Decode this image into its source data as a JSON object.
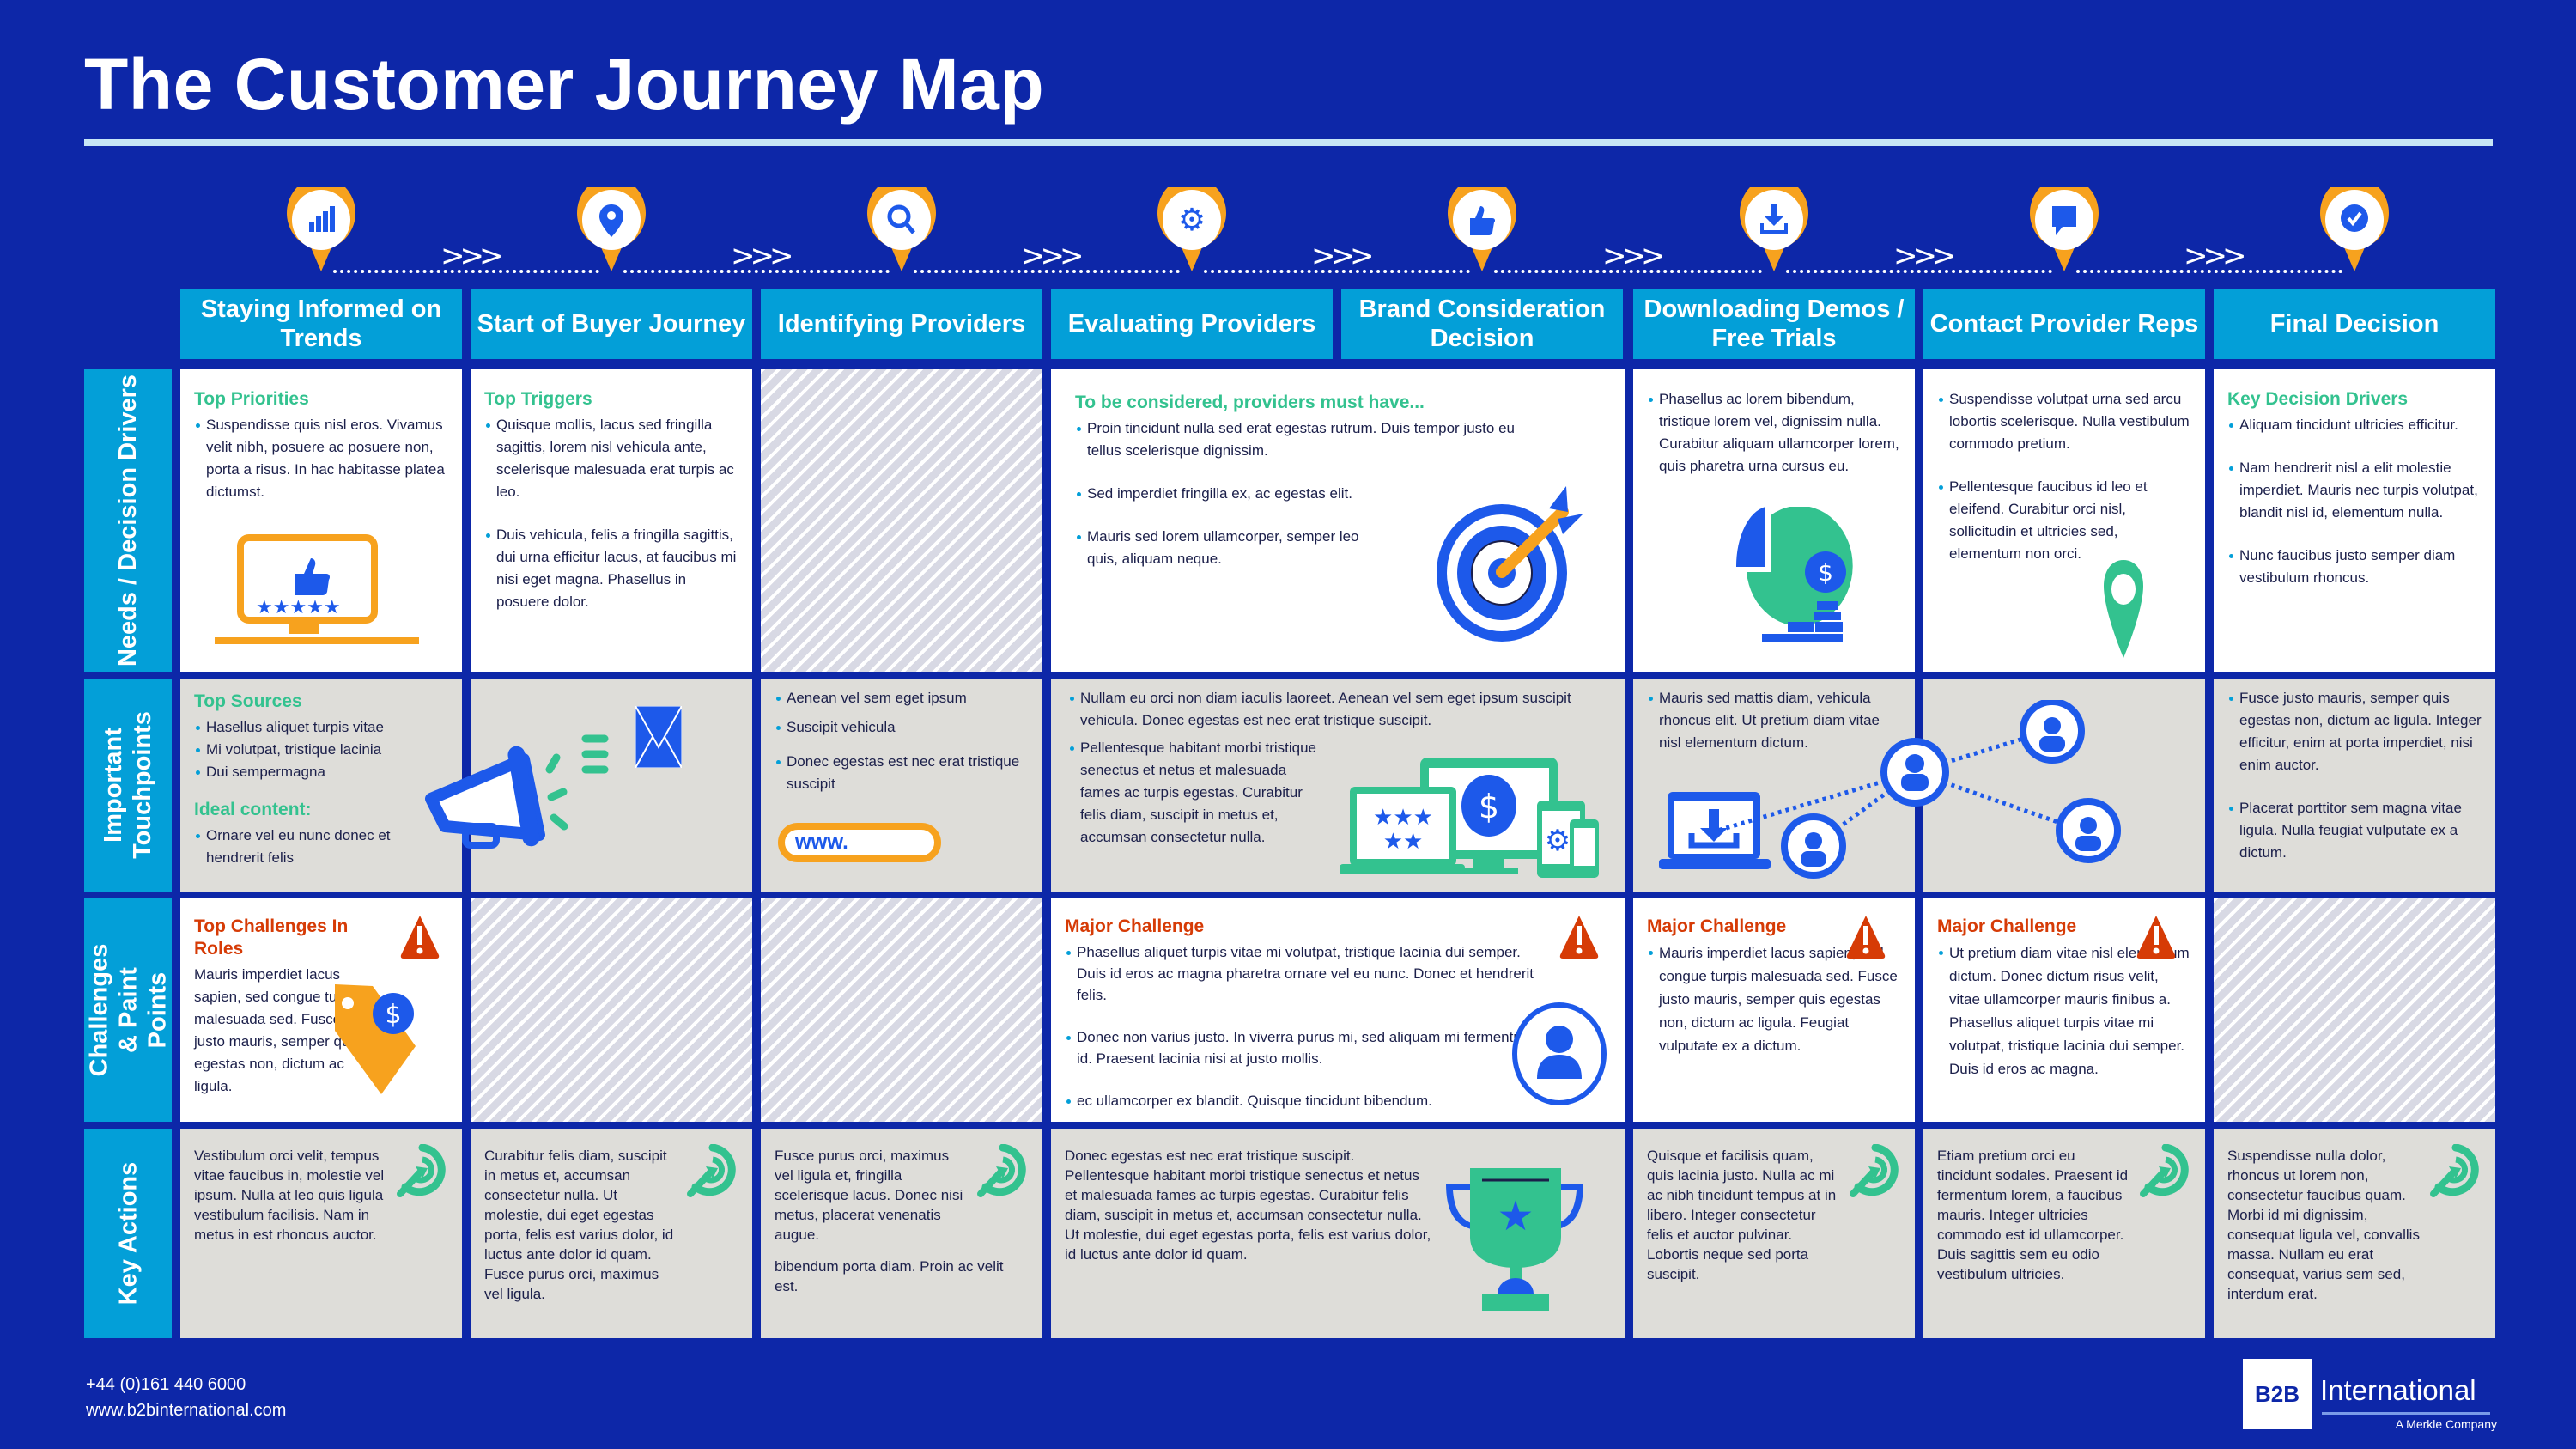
{
  "title": "The Customer Journey Map",
  "colors": {
    "background": "#0d27a8",
    "header_blue": "#039fd8",
    "accent_orange": "#f7a21e",
    "icon_blue": "#1d59ea",
    "heading_green": "#33c28f",
    "challenge_red": "#d63b06",
    "cell_gray": "#deddd9",
    "divider_light": "#c7e6f6"
  },
  "stages": [
    {
      "label": "Staying Informed on Trends",
      "icon": "bar-chart-icon"
    },
    {
      "label": "Start of Buyer Journey",
      "icon": "location-pin-icon"
    },
    {
      "label": "Identifying Providers",
      "icon": "search-icon"
    },
    {
      "label": "Evaluating Providers",
      "icon": "gear-icon"
    },
    {
      "label": "Brand Consideration Decision",
      "icon": "thumbs-up-icon"
    },
    {
      "label": "Downloading Demos / Free Trials",
      "icon": "download-icon"
    },
    {
      "label": "Contact Provider Reps",
      "icon": "speech-bubble-icon"
    },
    {
      "label": "Final Decision",
      "icon": "check-circle-icon"
    }
  ],
  "progress_arrows": ">>>",
  "rows": [
    {
      "label": "Needs / Decision Drivers"
    },
    {
      "label": "Important Touchpoints"
    },
    {
      "label": "Challenges & Paint Points"
    },
    {
      "label": "Key Actions"
    }
  ],
  "needs": {
    "staying_informed": {
      "heading": "Top Priorities",
      "bullets": [
        "Suspendisse quis nisl eros. Vivamus velit nibh, posuere ac posuere non, porta a risus. In hac habitasse platea dictumst."
      ],
      "illustration": "monitor-thumbs-up-stars-icon"
    },
    "start_of_journey": {
      "heading": "Top Triggers",
      "bullets": [
        "Quisque mollis, lacus sed fringilla sagittis, lorem nisl vehicula ante, scelerisque malesuada erat turpis ac leo.",
        "Duis vehicula, felis a fringilla sagittis, dui urna efficitur lacus, at faucibus mi nisi eget magna. Phasellus in posuere dolor."
      ]
    },
    "evaluating_brand": {
      "heading": "To be considered, providers must have...",
      "bullets": [
        "Proin tincidunt nulla sed erat egestas rutrum. Duis tempor justo eu tellus scelerisque dignissim.",
        "Sed imperdiet fringilla ex, ac egestas elit.",
        "Mauris sed lorem ullamcorper, semper leo quis, aliquam neque."
      ],
      "illustration": "target-arrow-icon"
    },
    "downloading": {
      "bullets": [
        "Phasellus ac lorem bibendum, tristique lorem vel, dignissim nulla. Curabitur aliquam ullamcorper lorem, quis pharetra urna cursus eu."
      ],
      "illustration": "pie-chart-coins-icon"
    },
    "contact_reps": {
      "bullets": [
        "Suspendisse volutpat urna sed arcu lobortis scelerisque. Nulla vestibulum commodo pretium.",
        "Pellentesque faucibus id leo et eleifend. Curabitur orci nisl, sollicitudin et ultricies sed, elementum non orci."
      ],
      "illustration": "map-marker-icon"
    },
    "final_decision": {
      "heading": "Key Decision Drivers",
      "bullets": [
        "Aliquam tincidunt ultricies efficitur.",
        "Nam hendrerit nisl a elit molestie imperdiet. Mauris nec turpis volutpat, blandit nisl id, elementum nulla.",
        "Nunc faucibus justo semper diam vestibulum rhoncus."
      ]
    }
  },
  "touchpoints": {
    "staying_informed": {
      "heading": "Top Sources",
      "bullets": [
        "Hasellus aliquet turpis vitae",
        "Mi volutpat, tristique lacinia",
        "Dui sempermagna"
      ],
      "heading2": "Ideal content:",
      "bullets2": [
        "Ornare vel eu nunc donec et hendrerit felis"
      ]
    },
    "identifying": {
      "bullets": [
        "Aenean vel sem eget ipsum",
        "Suscipit vehicula",
        "Donec egestas est nec erat tristique suscipit"
      ],
      "url_badge": "www."
    },
    "evaluating_brand": {
      "bullets": [
        "Nullam eu orci non diam iaculis laoreet. Aenean vel sem eget ipsum suscipit vehicula. Donec egestas est nec erat tristique suscipit.",
        "Pellentesque habitant morbi tristique senectus et netus et malesuada fames ac turpis egestas. Curabitur felis diam, suscipit in metus et, accumsan consectetur nulla."
      ],
      "illustration": "devices-icon"
    },
    "downloading": {
      "bullets": [
        "Mauris sed mattis diam, vehicula rhoncus elit. Ut pretium diam vitae nisl elementum dictum."
      ]
    },
    "final_decision": {
      "bullets": [
        "Fusce justo mauris, semper quis egestas non, dictum ac ligula. Integer efficitur, enim at porta imperdiet, nisi enim auctor.",
        "Placerat porttitor sem magna vitae ligula. Nulla feugiat vulputate ex a dictum."
      ]
    }
  },
  "challenges": {
    "staying_informed": {
      "heading": "Top Challenges In Roles",
      "text": "Mauris imperdiet lacus sapien, sed congue turpis malesuada sed. Fusce justo mauris, semper quis egestas non, dictum ac ligula."
    },
    "evaluating_brand": {
      "heading": "Major Challenge",
      "bullets": [
        "Phasellus aliquet turpis vitae mi volutpat, tristique lacinia dui semper. Duis id eros ac magna pharetra ornare vel eu nunc. Donec et hendrerit felis.",
        "Donec non varius justo. In viverra purus mi, sed aliquam mi fermentum id. Praesent lacinia nisi at justo mollis.",
        "ec ullamcorper ex blandit. Quisque tincidunt bibendum."
      ]
    },
    "downloading": {
      "heading": "Major Challenge",
      "bullets": [
        "Mauris imperdiet lacus sapien, sed congue turpis malesuada sed. Fusce justo mauris, semper quis egestas non, dictum ac ligula. Feugiat vulputate ex a dictum."
      ]
    },
    "contact_reps": {
      "heading": "Major Challenge",
      "bullets": [
        "Ut pretium diam vitae nisl elementum dictum. Donec dictum risus velit, vitae ullamcorper mauris finibus a. Phasellus aliquet turpis vitae mi volutpat, tristique lacinia dui semper. Duis id eros ac magna."
      ]
    }
  },
  "actions": {
    "staying_informed": "Vestibulum orci velit, tempus vitae faucibus in, molestie vel ipsum. Nulla at leo quis ligula vestibulum facilisis. Nam in metus in est rhoncus auctor.",
    "start_of_journey": "Curabitur felis diam, suscipit in metus et, accumsan consectetur nulla. Ut molestie, dui eget egestas porta, felis est varius dolor, id luctus ante dolor id quam. Fusce purus orci, maximus vel ligula.",
    "identifying": "Fusce purus orci, maximus vel ligula et, fringilla scelerisque lacus. Donec nisi metus, placerat venenatis augue.",
    "identifying_2": "bibendum porta diam. Proin ac velit est.",
    "evaluating_brand": "Donec egestas est nec erat tristique suscipit. Pellentesque habitant morbi tristique senectus et netus et malesuada fames ac turpis egestas. Curabitur felis diam, suscipit in metus et, accumsan consectetur nulla. Ut molestie, dui eget egestas porta, felis est varius dolor, id luctus ante dolor id quam.",
    "downloading": "Quisque et facilisis quam, quis lacinia justo. Nulla ac mi ac nibh tincidunt tempus at in libero. Integer consectetur felis et auctor pulvinar. Lobortis neque sed porta suscipit.",
    "contact_reps": "Etiam pretium orci eu tincidunt sodales. Praesent id fermentum lorem, a faucibus mauris. Integer ultricies commodo est id ullamcorper. Duis sagittis sem eu odio vestibulum ultricies.",
    "final_decision": "Suspendisse nulla dolor, rhoncus ut lorem non, consectetur faucibus quam. Morbi id mi dignissim, consequat ligula vel, convallis massa. Nullam eu erat consequat, varius sem sed, interdum erat."
  },
  "footer": {
    "phone": "+44 (0)161 440 6000",
    "website": "www.b2binternational.com",
    "logo_mark": "B2B",
    "logo_name": "International",
    "logo_tagline": "A Merkle Company"
  }
}
